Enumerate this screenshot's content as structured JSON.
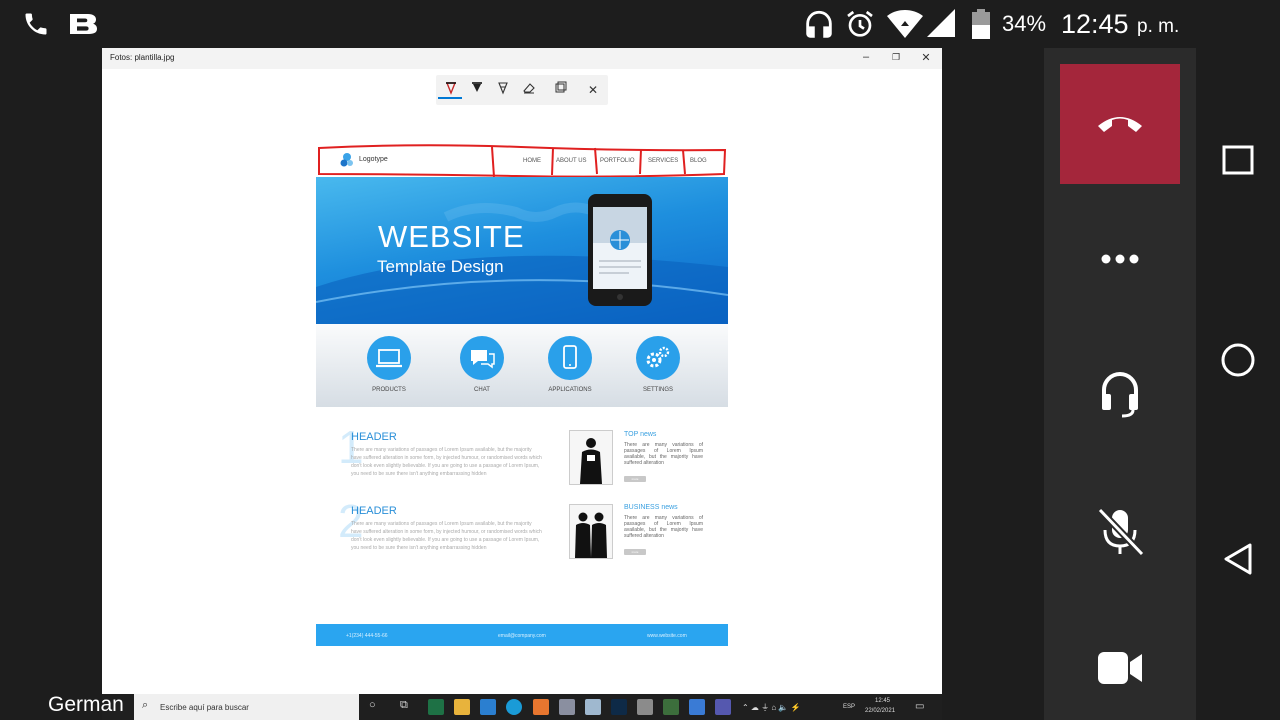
{
  "status_bar": {
    "battery_percent": "34%",
    "time": "12:45",
    "ampm": "p. m."
  },
  "window": {
    "title": "Fotos: plantilla.jpg"
  },
  "photo_toolbar": {
    "icons": [
      "pen-red-icon",
      "pen-black-icon",
      "highlighter-icon",
      "eraser-icon",
      "ruler-icon",
      "close-icon"
    ]
  },
  "site": {
    "logo": "Logotype",
    "nav": [
      "HOME",
      "ABOUT US",
      "PORTFOLIO",
      "SERVICES",
      "BLOG"
    ],
    "hero_title": "WEBSITE",
    "hero_subtitle": "Template Design",
    "features": [
      "PRODUCTS",
      "CHAT",
      "APPLICATIONS",
      "SETTINGS"
    ],
    "section1": {
      "number": "1",
      "header": "HEADER",
      "text": "There are many variations of passages of Lorem Ipsum available, but the majority have suffered alteration in some form, by injected humour, or randomised words which don't look even slightly believable. If you are going to use a passage of Lorem Ipsum, you need to be sure there isn't anything embarrassing hidden"
    },
    "section2": {
      "number": "2",
      "header": "HEADER",
      "text": "There are many variations of passages of Lorem Ipsum available, but the majority have suffered alteration in some form, by injected humour, or randomised words which don't look even slightly believable. If you are going to use a passage of Lorem Ipsum, you need to be sure there isn't anything embarrassing hidden"
    },
    "news1": {
      "title": "TOP news",
      "text": "There are many variations of passages of Lorem Ipsum available, but the majority have suffered alteration",
      "button": "more"
    },
    "news2": {
      "title": "BUSINESS news",
      "text": "There are many variations of passages of Lorem Ipsum available, but the majority have suffered alteration",
      "button": "more"
    },
    "footer": {
      "phone": "+1(234) 444-55-66",
      "email": "email@company.com",
      "web": "www.website.com"
    }
  },
  "taskbar": {
    "search_placeholder": "Escribe aquí para buscar",
    "lang": "ESP",
    "clock_time": "12:45",
    "clock_date": "22/02/2021"
  },
  "call_panel": {
    "end_call_color": "#a4263b"
  },
  "caption": "German"
}
